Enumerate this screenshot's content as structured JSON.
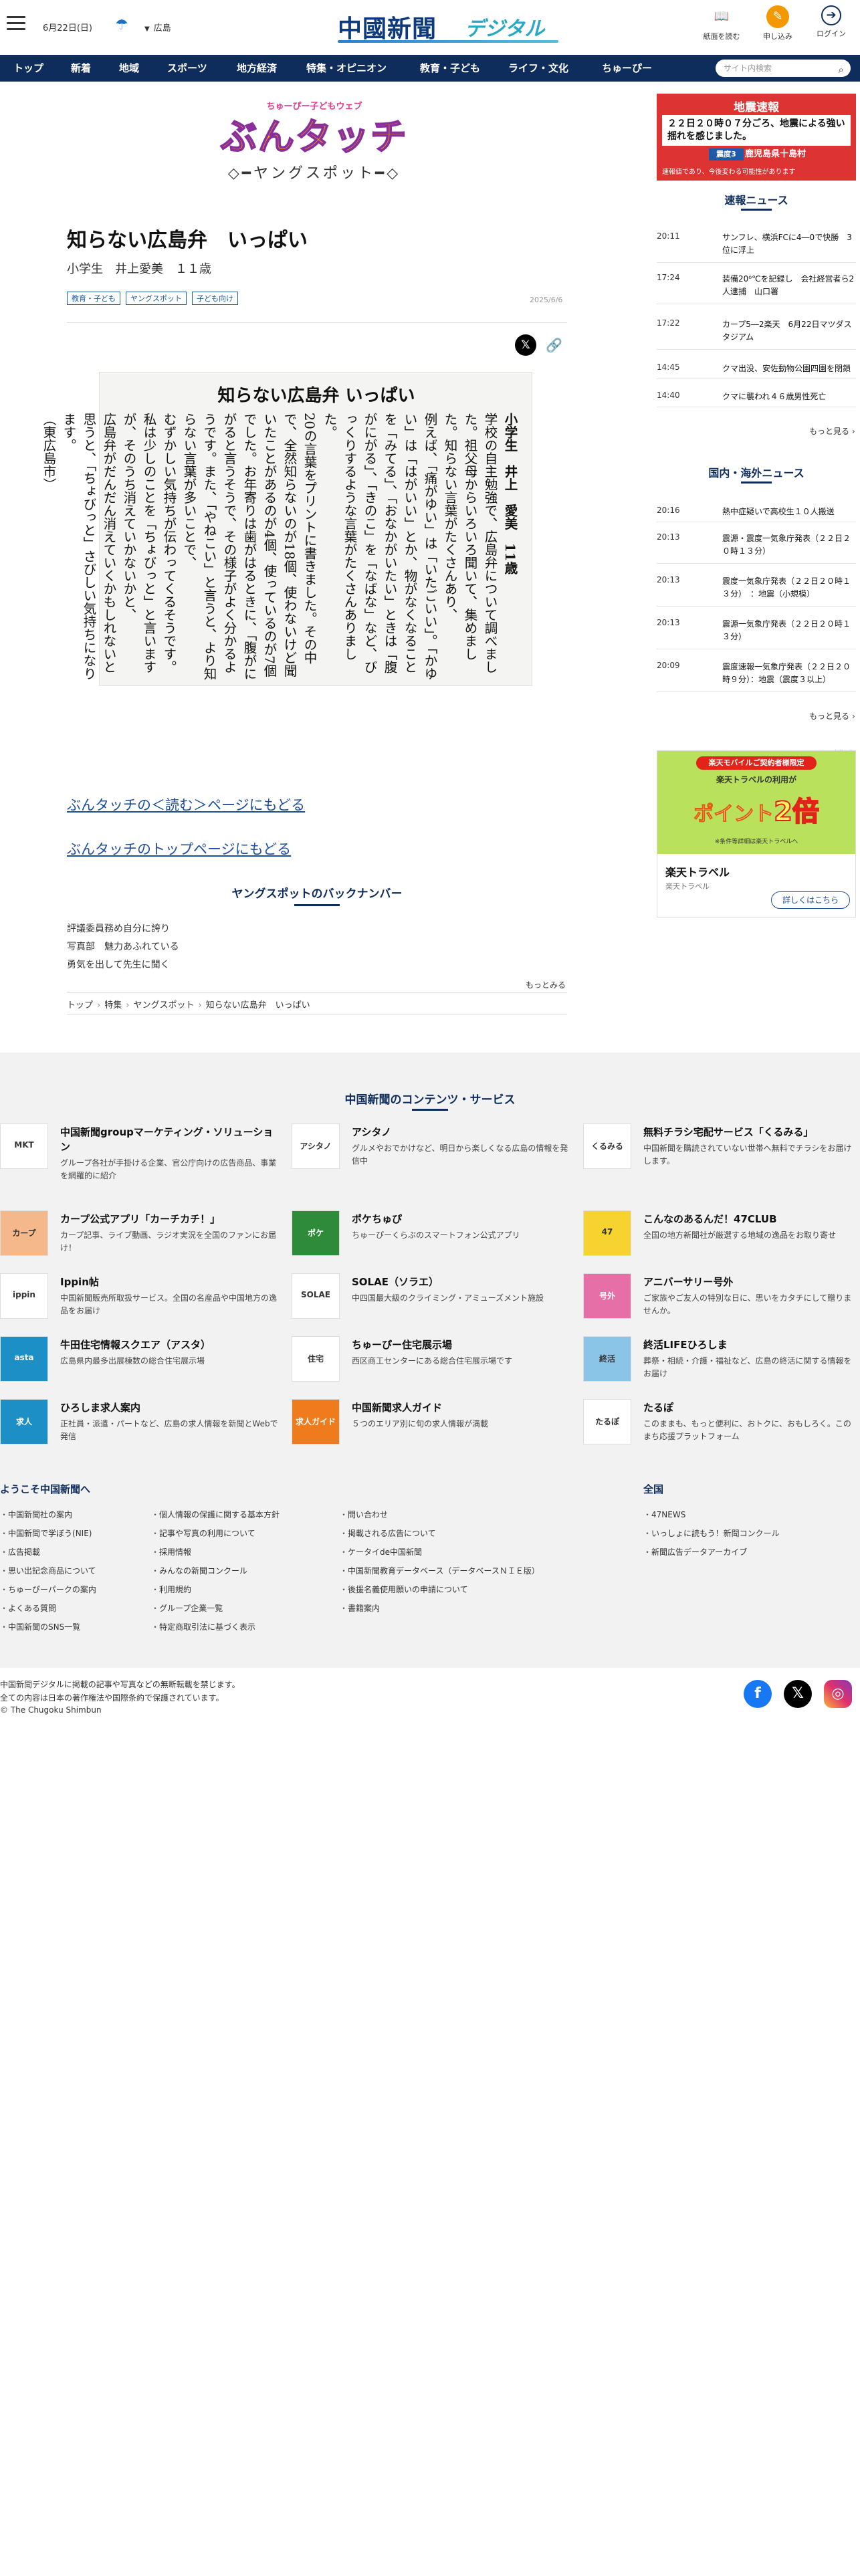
{
  "header": {
    "date": "6月22日(日)",
    "weather_icon": "umbrella-icon",
    "location": "広島",
    "logo_main": "中國新聞",
    "logo_sub": "デジタル",
    "actions": [
      {
        "label": "紙面を読む",
        "icon": "book-icon"
      },
      {
        "label": "申し込み",
        "icon": "subscribe-icon"
      },
      {
        "label": "ログイン",
        "icon": "login-icon"
      }
    ]
  },
  "nav": {
    "items": [
      "トップ",
      "新着",
      "地域",
      "スポーツ",
      "地方経済",
      "特集・オピニオン",
      "教育・子ども",
      "ライフ・文化",
      "ちゅーぴー"
    ],
    "search_placeholder": "サイト内検索"
  },
  "banner": {
    "top": "ちゅーぴー子どもウェブ",
    "title": "ぶんタッチ",
    "sub": "ヤングスポット"
  },
  "article": {
    "title": "知らない広島弁　いっぱい",
    "byline": "小学生　井上愛美　１１歳",
    "tags": [
      "教育・子ども",
      "ヤングスポット",
      "子ども向け"
    ],
    "date": "2025/6/6",
    "clip": {
      "heading": "知らない広島弁 いっぱい",
      "byline": "小学生　井上　愛美　11歳",
      "columns": [
        "学校の自主勉強で、広島弁について調べました。祖父母からいろいろ聞いて、集めました。知らない言葉がたくさんあり、",
        "例えば、「痛がゆい」は「いたごいい」。「かゆい」は「はがいい」とか、物がなくなることを「みてる」、「おなかがいたい」ときは「腹がにがる」、「きのこ」を「なばな」など、びっくりするような言葉がたくさんありました。",
        "20の言葉をプリントに書きました。その中で、全然知らないのが18個、使わないけど聞いたことがあるのが4個、使っているのが7個でした。お年寄りは歯がはるときに、「腹がにがると言うそうで、その様子がよく分かるようです。また、「やねこい」と言うと、より知らない言葉が多いことで、",
        "むずかしい気持ちが伝わってくるそうです。私は少しのことを「ちょびっと」と言いますが、そのうち消えていかないかと、",
        "広島弁がだんだん消えていくかもしれないと思うと、「ちょびっと」さびしい気持ちになります。",
        "（東広島市）"
      ]
    },
    "links": [
      "ぶんタッチの＜読む＞ページにもどる",
      "ぶんタッチのトップページにもどる"
    ],
    "backnumber_title": "ヤングスポットのバックナンバー",
    "backnumber": [
      "評議委員務め自分に誇り",
      "写真部　魅力あふれている",
      "勇気を出して先生に聞く"
    ],
    "more": "もっとみる",
    "breadcrumb": [
      "トップ",
      "特集",
      "ヤングスポット",
      "知らない広島弁　いっぱい"
    ]
  },
  "quake": {
    "header": "地震速報",
    "text": "２２日２０時０７分ごろ、地震による強い揺れを感じました。",
    "shindo_label": "震度3",
    "place": "鹿児島県十島村",
    "footer": "速報値であり、今後変わる可能性があります"
  },
  "breaking": {
    "title": "速報ニュース",
    "items": [
      {
        "time": "20:11",
        "text": "サンフレ、横浜FCに4―0で快勝　3位に浮上"
      },
      {
        "time": "17:24",
        "text": "装備20⁰℃を記録し　会社経営者ら2人逮捕　山口署"
      },
      {
        "time": "17:22",
        "text": "カープ5―2楽天　6月22日マツダスタジアム"
      },
      {
        "time": "14:45",
        "text": "クマ出没、安佐動物公園四園を閉鎖"
      },
      {
        "time": "14:40",
        "text": "クマに襲われ４６歳男性死亡"
      }
    ],
    "more": "もっと見る"
  },
  "world": {
    "title": "国内・海外ニュース",
    "items": [
      {
        "time": "20:16",
        "text": "熱中症疑いで高校生１０人搬送"
      },
      {
        "time": "20:13",
        "text": "震源・震度一気象庁発表（２２日２０時１３分）"
      },
      {
        "time": "20:13",
        "text": "震度一気象庁発表（２２日２０時１３分）　：地震（小規模）"
      },
      {
        "time": "20:13",
        "text": "震源一気象庁発表（２２日２０時１３分）"
      },
      {
        "time": "20:09",
        "text": "震度速報一気象庁発表（２２日２０時９分）：地震（震度３以上）"
      }
    ],
    "more": "もっと見る"
  },
  "ad": {
    "label": "広告",
    "pill": "楽天モバイルご契約者様限定",
    "line": "楽天トラベルの利用が",
    "big_a": "ポイント",
    "big_b": "2倍",
    "small": "※条件等詳細は楽天トラベルへ",
    "name": "楽天トラベル",
    "sub": "楽天トラベル",
    "button": "詳しくはこちら",
    "accent": "#b9e15c"
  },
  "footer": {
    "contents_title": "中国新聞のコンテンツ・サービス",
    "services": [
      {
        "name": "中国新聞groupマーケティング・ソリューション",
        "desc": "グループ各社が手掛ける企業、官公庁向けの広告商品、事業を網羅的に紹介",
        "icon": "marketing-logo-icon",
        "abbr": "MKT"
      },
      {
        "name": "アシタノ",
        "desc": "グルメやおでかけなど、明日から楽しくなる広島の情報を発信中",
        "icon": "ashitano-logo-icon",
        "abbr": "アシタノ"
      },
      {
        "name": "無料チラシ宅配サービス「くるみる」",
        "desc": "中国新聞を購読されていない世帯へ無料でチラシをお届けします。",
        "icon": "kurumiru-logo-icon",
        "abbr": "くるみる"
      },
      {
        "name": "カープ公式アプリ「カーチカチ！」",
        "desc": "カープ記事、ライブ動画、ラジオ実況を全国のファンにお届け！",
        "icon": "carp-app-icon",
        "abbr": "カープ"
      },
      {
        "name": "ポケちゅぴ",
        "desc": "ちゅーぴーくらぶのスマートフォン公式アプリ",
        "icon": "pokechupi-icon",
        "abbr": "ポケ"
      },
      {
        "name": "こんなのあるんだ！47CLUB",
        "desc": "全国の地方新聞社が厳選する地域の逸品をお取り寄せ",
        "icon": "47club-icon",
        "abbr": "47"
      },
      {
        "name": "Ippin帖",
        "desc": "中国新聞販売所取扱サービス。全国の名産品や中国地方の逸品をお届け",
        "icon": "ippin-logo-icon",
        "abbr": "ippin"
      },
      {
        "name": "SOLAE（ソラエ）",
        "desc": "中四国最大級のクライミング・アミューズメント施設",
        "icon": "solae-logo-icon",
        "abbr": "SOLAE"
      },
      {
        "name": "アニバーサリー号外",
        "desc": "ご家族やご友人の特別な日に、思いをカタチにして贈りませんか。",
        "icon": "anniversary-icon",
        "abbr": "号外"
      },
      {
        "name": "牛田住宅情報スクエア（アスタ）",
        "desc": "広島県内最多出展棟数の総合住宅展示場",
        "icon": "asta-logo-icon",
        "abbr": "asta"
      },
      {
        "name": "ちゅーぴー住宅展示場",
        "desc": "西区商工センターにある総合住宅展示場です",
        "icon": "house-icon",
        "abbr": "住宅"
      },
      {
        "name": "終活LIFEひろしま",
        "desc": "葬祭・相続・介護・福祉など、広島の終活に関する情報をお届け",
        "icon": "shukatsu-logo-icon",
        "abbr": "終活"
      },
      {
        "name": "ひろしま求人案内",
        "desc": "正社員・派遣・パートなど、広島の求人情報を新聞とWebで発信",
        "icon": "job-logo-icon",
        "abbr": "求人"
      },
      {
        "name": "中国新聞求人ガイド",
        "desc": "５つのエリア別に旬の求人情報が満載",
        "icon": "job-guide-icon",
        "abbr": "求人ガイド"
      },
      {
        "name": "たるぽ",
        "desc": "このままも、もっと便利に、おトクに、おもしろく。このまち応援プラットフォーム",
        "icon": "tarupo-logo-icon",
        "abbr": "たるぽ"
      }
    ],
    "welcome_title": "ようこそ中国新聞へ",
    "national_title": "全国",
    "links_col1": [
      "中国新聞社の案内",
      "中国新聞で学ぼう(NIE)",
      "広告掲載",
      "思い出記念商品について",
      "ちゅーぴーパークの案内",
      "よくある質問",
      "中国新聞のSNS一覧"
    ],
    "links_col2": [
      "個人情報の保護に関する基本方針",
      "記事や写真の利用について",
      "採用情報",
      "みんなの新聞コンクール",
      "利用規約",
      "グループ企業一覧",
      "特定商取引法に基づく表示"
    ],
    "links_col3": [
      "問い合わせ",
      "掲載される広告について",
      "ケータイde中国新聞",
      "中国新聞教育データベース（データベースＮＩＥ版）",
      "後援名義使用願いの申請について",
      "書籍案内"
    ],
    "links_col4": [
      "47NEWS",
      "いっしょに読もう！新聞コンクール",
      "新聞広告データアーカイブ"
    ],
    "note1": "中国新聞デジタルに掲載の記事や写真などの無断転載を禁じます。",
    "note2": "全ての内容は日本の著作権法や国際条約で保護されています。",
    "copyright": "© The Chugoku Shimbun",
    "sns": [
      "facebook-icon",
      "x-icon",
      "instagram-icon"
    ]
  }
}
